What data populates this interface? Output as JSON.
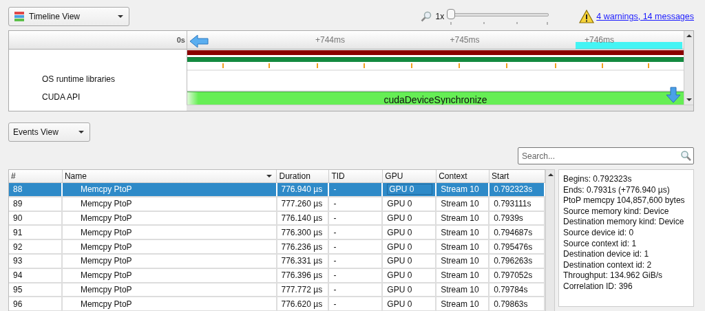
{
  "toolbar": {
    "view_selector": "Timeline View",
    "zoom_label": "1x",
    "zoom_slider": {
      "level": 0
    },
    "warnings_link": "4 warnings, 14 messages"
  },
  "timeline": {
    "origin_label": "0s",
    "ticks": [
      "+744ms",
      "+745ms",
      "+746ms"
    ],
    "rows": [
      {
        "label": "OS runtime libraries"
      },
      {
        "label": "CUDA API",
        "event": "cudaDeviceSynchronize"
      }
    ]
  },
  "events": {
    "view_selector": "Events View",
    "search": {
      "placeholder": "Search..."
    },
    "columns": [
      {
        "label": "#",
        "sorted": false
      },
      {
        "label": "Name",
        "sorted": true
      },
      {
        "label": "Duration",
        "sorted": false
      },
      {
        "label": "TID",
        "sorted": false
      },
      {
        "label": "GPU",
        "sorted": false
      },
      {
        "label": "Context",
        "sorted": false
      },
      {
        "label": "Start",
        "sorted": false
      }
    ],
    "rows": [
      {
        "selected": true,
        "cells": [
          "88",
          "Memcpy PtoP",
          "776.940 µs",
          "-",
          "GPU 0",
          "Stream 10",
          "0.792323s"
        ]
      },
      {
        "selected": false,
        "cells": [
          "89",
          "Memcpy PtoP",
          "777.260 µs",
          "-",
          "GPU 0",
          "Stream 10",
          "0.793111s"
        ]
      },
      {
        "selected": false,
        "cells": [
          "90",
          "Memcpy PtoP",
          "776.140 µs",
          "-",
          "GPU 0",
          "Stream 10",
          "0.7939s"
        ]
      },
      {
        "selected": false,
        "cells": [
          "91",
          "Memcpy PtoP",
          "776.300 µs",
          "-",
          "GPU 0",
          "Stream 10",
          "0.794687s"
        ]
      },
      {
        "selected": false,
        "cells": [
          "92",
          "Memcpy PtoP",
          "776.236 µs",
          "-",
          "GPU 0",
          "Stream 10",
          "0.795476s"
        ]
      },
      {
        "selected": false,
        "cells": [
          "93",
          "Memcpy PtoP",
          "776.331 µs",
          "-",
          "GPU 0",
          "Stream 10",
          "0.796263s"
        ]
      },
      {
        "selected": false,
        "cells": [
          "94",
          "Memcpy PtoP",
          "776.396 µs",
          "-",
          "GPU 0",
          "Stream 10",
          "0.797052s"
        ]
      },
      {
        "selected": false,
        "cells": [
          "95",
          "Memcpy PtoP",
          "777.772 µs",
          "-",
          "GPU 0",
          "Stream 10",
          "0.79784s"
        ]
      },
      {
        "selected": false,
        "cells": [
          "96",
          "Memcpy PtoP",
          "776.620 µs",
          "-",
          "GPU 0",
          "Stream 10",
          "0.79863s"
        ]
      }
    ],
    "details": [
      "Begins: 0.792323s",
      "Ends: 0.7931s (+776.940 µs)",
      "PtoP memcpy 104,857,600 bytes",
      "Source memory kind: Device",
      "Destination memory kind: Device",
      "Source device id: 0",
      "Source context id: 1",
      "Destination device id: 1",
      "Destination context id: 2",
      "Throughput: 134.962 GiB/s",
      "Correlation ID: 396"
    ]
  }
}
